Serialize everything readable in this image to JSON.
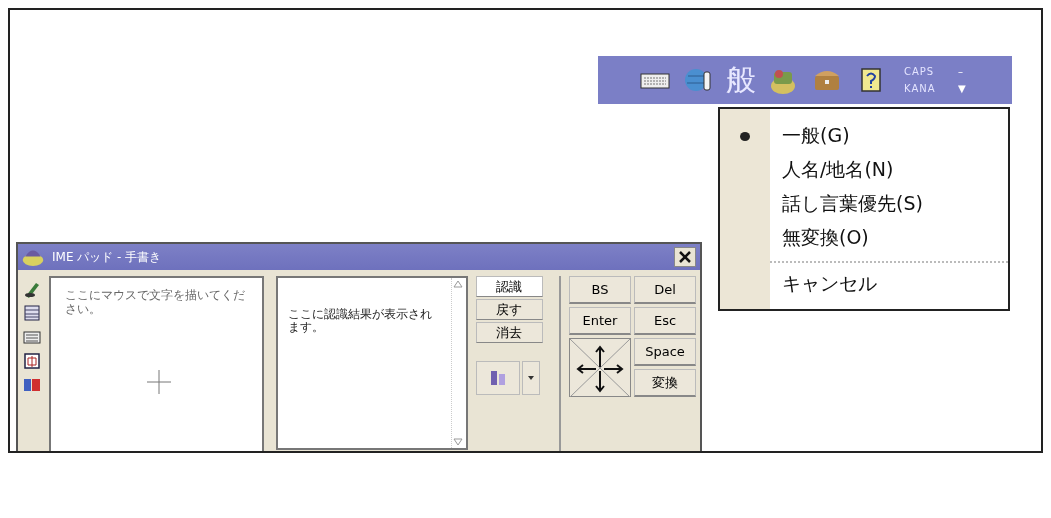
{
  "language_bar": {
    "mode_glyph": "般",
    "indicators": [
      "CAPS",
      "KANA"
    ],
    "minimize": "–",
    "options": "▼"
  },
  "mode_menu": {
    "items": [
      {
        "label": "一般(G)",
        "selected": true
      },
      {
        "label": "人名/地名(N)",
        "selected": false
      },
      {
        "label": "話し言葉優先(S)",
        "selected": false
      },
      {
        "label": "無変換(O)",
        "selected": false
      }
    ],
    "cancel": "キャンセル"
  },
  "ime_pad": {
    "title": "IME パッド - 手書き",
    "writing_area": {
      "hint": "ここにマウスで文字を描いてください。"
    },
    "result_area": {
      "hint": "ここに認識結果が表示されます。"
    },
    "actions": [
      "認識",
      "戻す",
      "消去"
    ],
    "keys": [
      "BS",
      "Del",
      "Enter",
      "Esc",
      "Space",
      "変換"
    ]
  }
}
